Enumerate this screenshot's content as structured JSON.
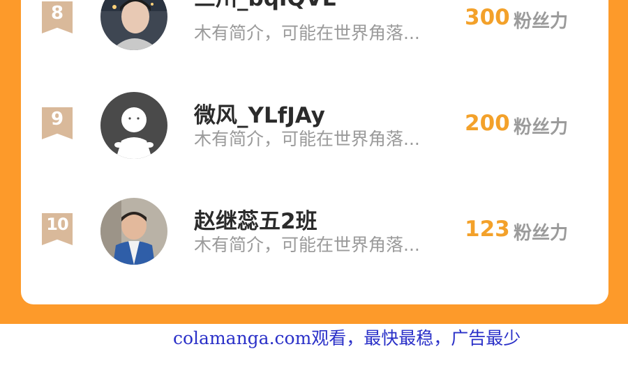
{
  "entries": [
    {
      "rank": "8",
      "name": "三川_bqIQVE",
      "bio": "木有简介，可能在世界角落...",
      "score": "300",
      "unit": "粉丝力",
      "avatar": "photo-avatar"
    },
    {
      "rank": "9",
      "name": "微风_YLfJAy",
      "bio": "木有简介，可能在世界角落...",
      "score": "200",
      "unit": "粉丝力",
      "avatar": "default-avatar"
    },
    {
      "rank": "10",
      "name": "赵继蕊五2班",
      "bio": "木有简介，可能在世界角落...",
      "score": "123",
      "unit": "粉丝力",
      "avatar": "photo-avatar"
    }
  ],
  "footer": {
    "text": "colamanga.com观看，最快最稳，广告最少"
  },
  "colors": {
    "accent": "#fd9a2a",
    "score": "#f3a12a",
    "rank_badge": "#d9b99a",
    "footer_link": "#2a30c8"
  }
}
